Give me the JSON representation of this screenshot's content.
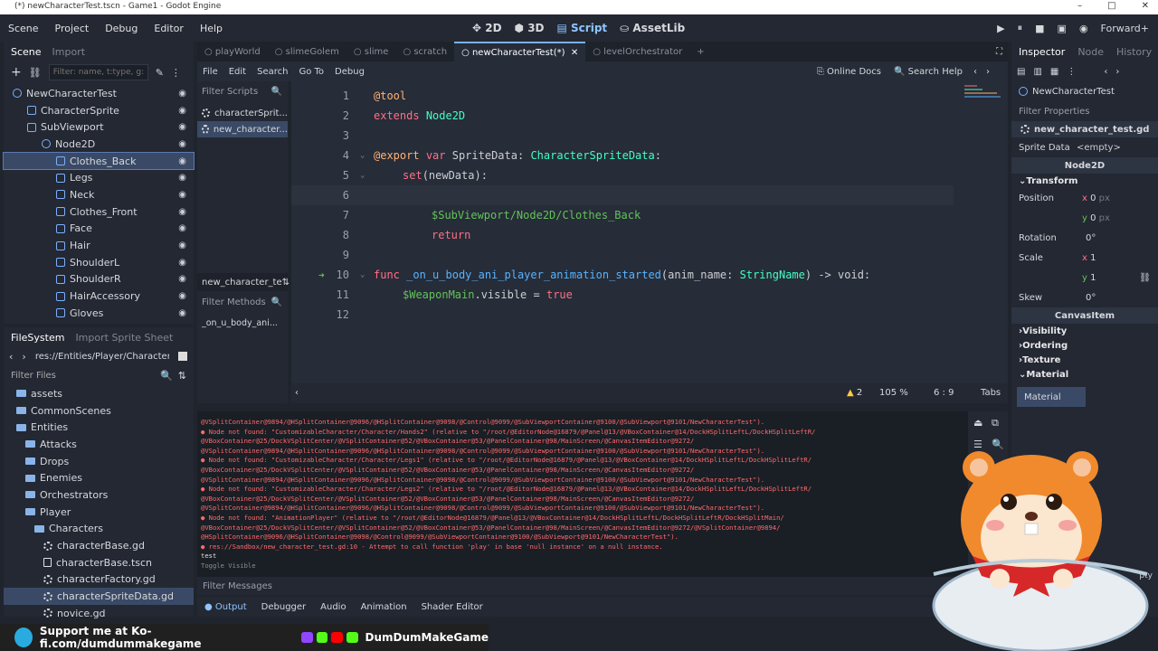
{
  "window": {
    "title": "(*) newCharacterTest.tscn - Game1 - Godot Engine",
    "controls": [
      "–",
      "□",
      "✕"
    ]
  },
  "menu": [
    "Scene",
    "Project",
    "Debug",
    "Editor",
    "Help"
  ],
  "modes": [
    "2D",
    "3D",
    "Script",
    "AssetLib"
  ],
  "renderer": "Forward+",
  "scene_dock": {
    "tabs": [
      "Scene",
      "Import"
    ],
    "filter_placeholder": "Filter: name, t:type, g:",
    "nodes": [
      {
        "label": "NewCharacterTest",
        "indent": 0
      },
      {
        "label": "CharacterSprite",
        "indent": 1
      },
      {
        "label": "SubViewport",
        "indent": 1
      },
      {
        "label": "Node2D",
        "indent": 2
      },
      {
        "label": "Clothes_Back",
        "indent": 3,
        "selected": true
      },
      {
        "label": "Legs",
        "indent": 3
      },
      {
        "label": "Neck",
        "indent": 3
      },
      {
        "label": "Clothes_Front",
        "indent": 3
      },
      {
        "label": "Face",
        "indent": 3
      },
      {
        "label": "Hair",
        "indent": 3
      },
      {
        "label": "ShoulderL",
        "indent": 3
      },
      {
        "label": "ShoulderR",
        "indent": 3
      },
      {
        "label": "HairAccessory",
        "indent": 3
      },
      {
        "label": "Gloves",
        "indent": 3
      }
    ]
  },
  "filesystem": {
    "tabs": [
      "FileSystem",
      "Import Sprite Sheet"
    ],
    "path": "res://Entities/Player/Characters/c",
    "filter_placeholder": "Filter Files",
    "items": [
      {
        "label": "assets",
        "type": "folder",
        "indent": 1
      },
      {
        "label": "CommonScenes",
        "type": "folder",
        "indent": 1
      },
      {
        "label": "Entities",
        "type": "folder",
        "indent": 1
      },
      {
        "label": "Attacks",
        "type": "folder",
        "indent": 2
      },
      {
        "label": "Drops",
        "type": "folder",
        "indent": 2
      },
      {
        "label": "Enemies",
        "type": "folder",
        "indent": 2
      },
      {
        "label": "Orchestrators",
        "type": "folder",
        "indent": 2
      },
      {
        "label": "Player",
        "type": "folder",
        "indent": 2
      },
      {
        "label": "Characters",
        "type": "folder",
        "indent": 3
      },
      {
        "label": "characterBase.gd",
        "type": "script",
        "indent": 4
      },
      {
        "label": "characterBase.tscn",
        "type": "file",
        "indent": 4
      },
      {
        "label": "characterFactory.gd",
        "type": "script",
        "indent": 4
      },
      {
        "label": "characterSpriteData.gd",
        "type": "script",
        "indent": 4,
        "selected": true
      },
      {
        "label": "novice.gd",
        "type": "script",
        "indent": 4
      }
    ]
  },
  "doc_tabs": [
    {
      "label": "playWorld",
      "active": false
    },
    {
      "label": "slimeGolem",
      "active": false
    },
    {
      "label": "slime",
      "active": false
    },
    {
      "label": "scratch",
      "active": false
    },
    {
      "label": "newCharacterTest(*)",
      "active": true
    },
    {
      "label": "levelOrchestrator",
      "active": false
    }
  ],
  "script_menu": [
    "File",
    "Edit",
    "Search",
    "Go To",
    "Debug"
  ],
  "online_docs": "Online Docs",
  "search_help": "Search Help",
  "script_list": {
    "filter_placeholder": "Filter Scripts",
    "scripts": [
      "characterSprit...",
      "new_character..."
    ],
    "current": "new_character_te",
    "methods_placeholder": "Filter Methods",
    "methods": [
      "_on_u_body_ani..."
    ]
  },
  "code": {
    "lines": [
      {
        "n": "1",
        "text": "@tool"
      },
      {
        "n": "2",
        "text": "extends Node2D"
      },
      {
        "n": "3",
        "text": ""
      },
      {
        "n": "4",
        "text": "@export var SpriteData: CharacterSpriteData:"
      },
      {
        "n": "5",
        "text": "    set(newData):"
      },
      {
        "n": "6",
        "text": ""
      },
      {
        "n": "7",
        "text": "        $SubViewport/Node2D/Clothes_Back"
      },
      {
        "n": "8",
        "text": "        return"
      },
      {
        "n": "9",
        "text": ""
      },
      {
        "n": "10",
        "text": "func _on_u_body_ani_player_animation_started(anim_name: StringName) -> void:"
      },
      {
        "n": "11",
        "text": "    $WeaponMain.visible = true"
      },
      {
        "n": "12",
        "text": ""
      }
    ],
    "t_at": "@tool",
    "t_extends": "extends",
    "t_node2d": "Node2D",
    "t_export": "@export",
    "t_var": "var",
    "t_spritedata": "SpriteData:",
    "t_cstype": "CharacterSpriteData",
    "t_colon": ":",
    "t_set": "set",
    "t_newdata": "(newData):",
    "t_path": "$SubViewport/Node2D/Clothes_Back",
    "t_return": "return",
    "t_func": "func",
    "t_fname": "_on_u_body_ani_player_animation_started",
    "t_args": "(anim_name:",
    "t_sn": "StringName",
    "t_ret": ") ->",
    "t_void": "void",
    "t_colon2": ":",
    "t_weapon": "$WeaponMain",
    "t_visible": ".visible =",
    "t_true": "true"
  },
  "status": {
    "warnings": "2",
    "zoom": "105 %",
    "position": "6 : 9",
    "indent": "Tabs"
  },
  "output": {
    "lines": [
      {
        "t": "@VSplitContainer@9894/@HSplitContainer@9096/@HSplitContainer@9098/@Control@9099/@SubViewportContainer@9100/@SubViewport@9101/NewCharacterTest\").",
        "c": "red"
      },
      {
        "t": "● Node not found: \"CustomizableCharacter/Character/Hands2\" (relative to \"/root/@EditorNode@16879/@Panel@13/@VBoxContainer@14/DockHSplitLeftL/DockHSplitLeftR/",
        "c": "red"
      },
      {
        "t": "@VBoxContainer@25/DockVSplitCenter/@VSplitContainer@52/@VBoxContainer@53/@PanelContainer@98/MainScreen/@CanvasItemEditor@9272/",
        "c": "red"
      },
      {
        "t": "@VSplitContainer@9894/@HSplitContainer@9096/@HSplitContainer@9098/@Control@9099/@SubViewportContainer@9100/@SubViewport@9101/NewCharacterTest\").",
        "c": "red"
      },
      {
        "t": "● Node not found: \"CustomizableCharacter/Character/Legs1\" (relative to \"/root/@EditorNode@16879/@Panel@13/@VBoxContainer@14/DockHSplitLeftL/DockHSplitLeftR/",
        "c": "red"
      },
      {
        "t": "@VBoxContainer@25/DockVSplitCenter/@VSplitContainer@52/@VBoxContainer@53/@PanelContainer@98/MainScreen/@CanvasItemEditor@9272/",
        "c": "red"
      },
      {
        "t": "@VSplitContainer@9894/@HSplitContainer@9096/@HSplitContainer@9098/@Control@9099/@SubViewportContainer@9100/@SubViewport@9101/NewCharacterTest\").",
        "c": "red"
      },
      {
        "t": "● Node not found: \"CustomizableCharacter/Character/Legs2\" (relative to \"/root/@EditorNode@16879/@Panel@13/@VBoxContainer@14/DockHSplitLeftL/DockHSplitLeftR/",
        "c": "red"
      },
      {
        "t": "@VBoxContainer@25/DockVSplitCenter/@VSplitContainer@52/@VBoxContainer@53/@PanelContainer@98/MainScreen/@CanvasItemEditor@9272/",
        "c": "red"
      },
      {
        "t": "@VSplitContainer@9894/@HSplitContainer@9096/@HSplitContainer@9098/@Control@9099/@SubViewportContainer@9100/@SubViewport@9101/NewCharacterTest\").",
        "c": "red"
      },
      {
        "t": "● Node not found: \"AnimationPlayer\" (relative to \"/root/@EditorNode@16879/@Panel@13/@VBoxContainer@14/DockHSplitLeftL/DockHSplitLeftR/DockHSplitMain/",
        "c": "red"
      },
      {
        "t": "@VBoxContainer@25/DockVSplitCenter/@VSplitContainer@52/@VBoxContainer@53/@PanelContainer@98/MainScreen/@CanvasItemEditor@9272/@VSplitContainer@9894/",
        "c": "red"
      },
      {
        "t": "@HSplitContainer@9096/@HSplitContainer@9098/@Control@9099/@SubViewportContainer@9100/@SubViewport@9101/NewCharacterTest\").",
        "c": "red"
      },
      {
        "t": "● res://Sandbox/new_character_test.gd:10 - Attempt to call function 'play' in base 'null instance' on a null instance.",
        "c": "red"
      },
      {
        "t": "test",
        "c": "white"
      },
      {
        "t": "Toggle Visible",
        "c": "grey"
      }
    ],
    "filter_placeholder": "Filter Messages"
  },
  "bottom_tabs": [
    "Output",
    "Debugger",
    "Audio",
    "Animation",
    "Shader Editor"
  ],
  "inspector": {
    "tabs": [
      "Inspector",
      "Node",
      "History"
    ],
    "node": "NewCharacterTest",
    "filter_placeholder": "Filter Properties",
    "script": "new_character_test.gd",
    "sprite_data_label": "Sprite Data",
    "sprite_data_value": "<empty>",
    "node2d": "Node2D",
    "transform": "Transform",
    "position_label": "Position",
    "pos_x": "0",
    "pos_y": "0",
    "px": "px",
    "rotation_label": "Rotation",
    "rotation": "0",
    "scale_label": "Scale",
    "scale_x": "1",
    "scale_y": "1",
    "skew_label": "Skew",
    "skew": "0",
    "canvas_item": "CanvasItem",
    "sections": [
      "Visibility",
      "Ordering",
      "Texture",
      "Material"
    ],
    "material_label": "Material",
    "empty_tail": "pty"
  },
  "banner": {
    "support": "Support me at Ko-fi.com/dumdummakegame",
    "channel": "DumDumMakeGame"
  },
  "colors": {
    "accent": "#7ab0ff",
    "keyword": "#ff7085",
    "type": "#42ffc2",
    "function": "#57b3ff",
    "error": "#ff6b6b"
  }
}
